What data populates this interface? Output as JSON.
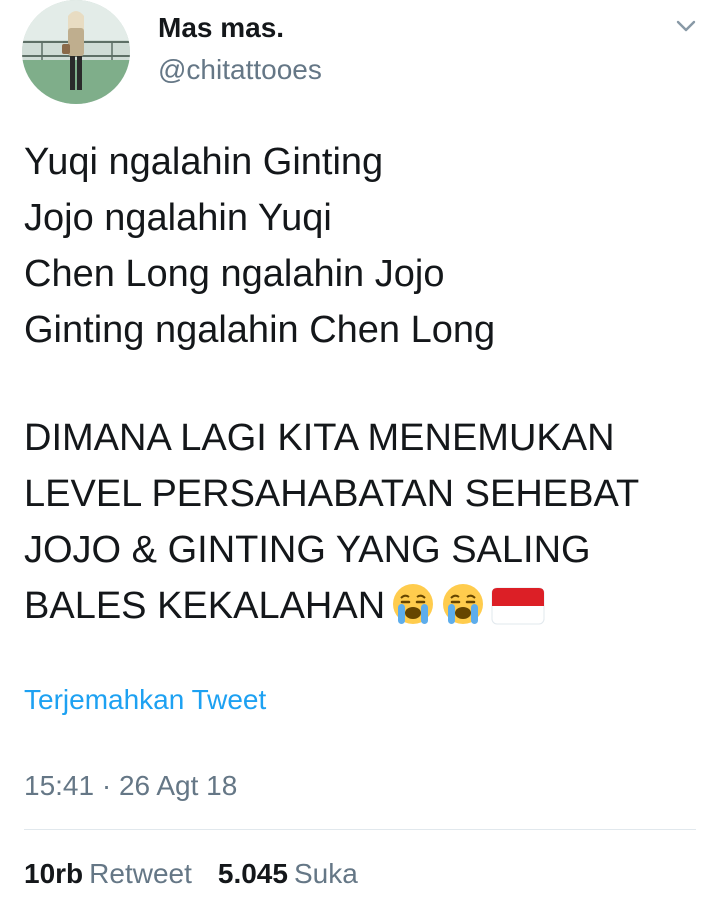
{
  "author": {
    "display_name": "Mas mas.",
    "handle": "@chitattooes"
  },
  "tweet": {
    "lines": [
      "Yuqi ngalahin Ginting",
      "Jojo ngalahin Yuqi",
      "Chen Long ngalahin Jojo",
      "Ginting ngalahin Chen Long",
      "DIMANA LAGI KITA MENEMUKAN",
      "LEVEL PERSAHABATAN SEHEBAT",
      "JOJO & GINTING YANG SALING",
      "BALES KEKALAHAN"
    ],
    "emojis": [
      "crying-face-emoji",
      "crying-face-emoji",
      "indonesia-flag-emoji"
    ],
    "translate_label": "Terjemahkan Tweet",
    "timestamp": "15:41 · 26 Agt 18"
  },
  "stats": {
    "retweets_count": "10rb",
    "retweets_label": "Retweet",
    "likes_count": "5.045",
    "likes_label": "Suka"
  },
  "icons": {
    "menu": "chevron-down-icon"
  },
  "colors": {
    "text": "#14171a",
    "secondary": "#657786",
    "link": "#1da1f2",
    "divider": "#e1e8ed"
  }
}
